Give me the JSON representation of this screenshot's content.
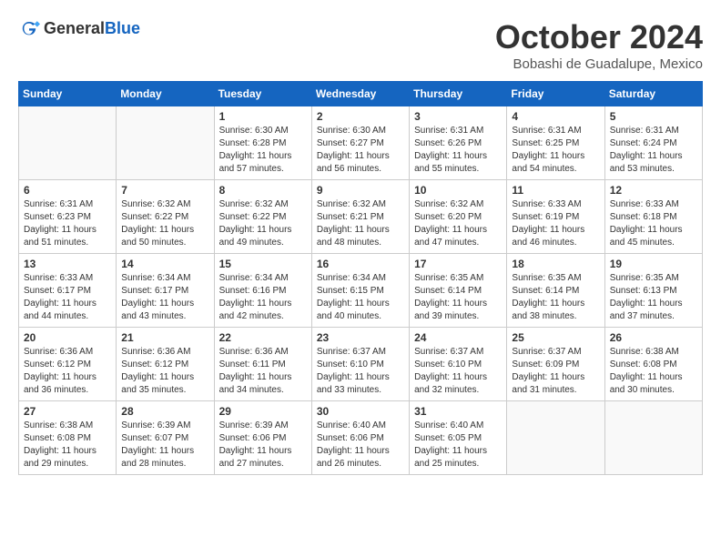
{
  "header": {
    "logo_general": "General",
    "logo_blue": "Blue",
    "month_title": "October 2024",
    "location": "Bobashi de Guadalupe, Mexico"
  },
  "weekdays": [
    "Sunday",
    "Monday",
    "Tuesday",
    "Wednesday",
    "Thursday",
    "Friday",
    "Saturday"
  ],
  "weeks": [
    [
      {
        "day": "",
        "info": ""
      },
      {
        "day": "",
        "info": ""
      },
      {
        "day": "1",
        "info": "Sunrise: 6:30 AM\nSunset: 6:28 PM\nDaylight: 11 hours\nand 57 minutes."
      },
      {
        "day": "2",
        "info": "Sunrise: 6:30 AM\nSunset: 6:27 PM\nDaylight: 11 hours\nand 56 minutes."
      },
      {
        "day": "3",
        "info": "Sunrise: 6:31 AM\nSunset: 6:26 PM\nDaylight: 11 hours\nand 55 minutes."
      },
      {
        "day": "4",
        "info": "Sunrise: 6:31 AM\nSunset: 6:25 PM\nDaylight: 11 hours\nand 54 minutes."
      },
      {
        "day": "5",
        "info": "Sunrise: 6:31 AM\nSunset: 6:24 PM\nDaylight: 11 hours\nand 53 minutes."
      }
    ],
    [
      {
        "day": "6",
        "info": "Sunrise: 6:31 AM\nSunset: 6:23 PM\nDaylight: 11 hours\nand 51 minutes."
      },
      {
        "day": "7",
        "info": "Sunrise: 6:32 AM\nSunset: 6:22 PM\nDaylight: 11 hours\nand 50 minutes."
      },
      {
        "day": "8",
        "info": "Sunrise: 6:32 AM\nSunset: 6:22 PM\nDaylight: 11 hours\nand 49 minutes."
      },
      {
        "day": "9",
        "info": "Sunrise: 6:32 AM\nSunset: 6:21 PM\nDaylight: 11 hours\nand 48 minutes."
      },
      {
        "day": "10",
        "info": "Sunrise: 6:32 AM\nSunset: 6:20 PM\nDaylight: 11 hours\nand 47 minutes."
      },
      {
        "day": "11",
        "info": "Sunrise: 6:33 AM\nSunset: 6:19 PM\nDaylight: 11 hours\nand 46 minutes."
      },
      {
        "day": "12",
        "info": "Sunrise: 6:33 AM\nSunset: 6:18 PM\nDaylight: 11 hours\nand 45 minutes."
      }
    ],
    [
      {
        "day": "13",
        "info": "Sunrise: 6:33 AM\nSunset: 6:17 PM\nDaylight: 11 hours\nand 44 minutes."
      },
      {
        "day": "14",
        "info": "Sunrise: 6:34 AM\nSunset: 6:17 PM\nDaylight: 11 hours\nand 43 minutes."
      },
      {
        "day": "15",
        "info": "Sunrise: 6:34 AM\nSunset: 6:16 PM\nDaylight: 11 hours\nand 42 minutes."
      },
      {
        "day": "16",
        "info": "Sunrise: 6:34 AM\nSunset: 6:15 PM\nDaylight: 11 hours\nand 40 minutes."
      },
      {
        "day": "17",
        "info": "Sunrise: 6:35 AM\nSunset: 6:14 PM\nDaylight: 11 hours\nand 39 minutes."
      },
      {
        "day": "18",
        "info": "Sunrise: 6:35 AM\nSunset: 6:14 PM\nDaylight: 11 hours\nand 38 minutes."
      },
      {
        "day": "19",
        "info": "Sunrise: 6:35 AM\nSunset: 6:13 PM\nDaylight: 11 hours\nand 37 minutes."
      }
    ],
    [
      {
        "day": "20",
        "info": "Sunrise: 6:36 AM\nSunset: 6:12 PM\nDaylight: 11 hours\nand 36 minutes."
      },
      {
        "day": "21",
        "info": "Sunrise: 6:36 AM\nSunset: 6:12 PM\nDaylight: 11 hours\nand 35 minutes."
      },
      {
        "day": "22",
        "info": "Sunrise: 6:36 AM\nSunset: 6:11 PM\nDaylight: 11 hours\nand 34 minutes."
      },
      {
        "day": "23",
        "info": "Sunrise: 6:37 AM\nSunset: 6:10 PM\nDaylight: 11 hours\nand 33 minutes."
      },
      {
        "day": "24",
        "info": "Sunrise: 6:37 AM\nSunset: 6:10 PM\nDaylight: 11 hours\nand 32 minutes."
      },
      {
        "day": "25",
        "info": "Sunrise: 6:37 AM\nSunset: 6:09 PM\nDaylight: 11 hours\nand 31 minutes."
      },
      {
        "day": "26",
        "info": "Sunrise: 6:38 AM\nSunset: 6:08 PM\nDaylight: 11 hours\nand 30 minutes."
      }
    ],
    [
      {
        "day": "27",
        "info": "Sunrise: 6:38 AM\nSunset: 6:08 PM\nDaylight: 11 hours\nand 29 minutes."
      },
      {
        "day": "28",
        "info": "Sunrise: 6:39 AM\nSunset: 6:07 PM\nDaylight: 11 hours\nand 28 minutes."
      },
      {
        "day": "29",
        "info": "Sunrise: 6:39 AM\nSunset: 6:06 PM\nDaylight: 11 hours\nand 27 minutes."
      },
      {
        "day": "30",
        "info": "Sunrise: 6:40 AM\nSunset: 6:06 PM\nDaylight: 11 hours\nand 26 minutes."
      },
      {
        "day": "31",
        "info": "Sunrise: 6:40 AM\nSunset: 6:05 PM\nDaylight: 11 hours\nand 25 minutes."
      },
      {
        "day": "",
        "info": ""
      },
      {
        "day": "",
        "info": ""
      }
    ]
  ]
}
